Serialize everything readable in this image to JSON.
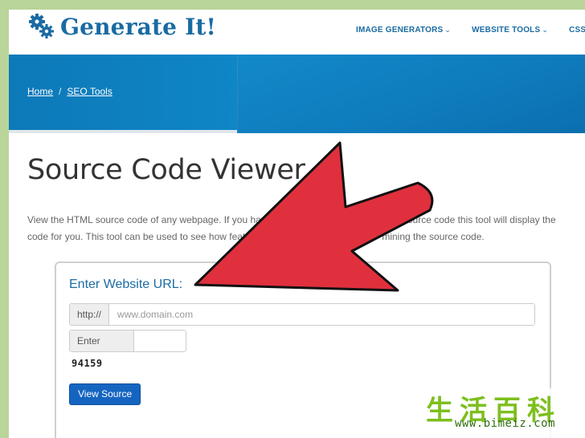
{
  "header": {
    "logo_text": "Generate It!",
    "logo_icon": "gears-icon",
    "nav": [
      {
        "label": "IMAGE GENERATORS",
        "caret": "⌄"
      },
      {
        "label": "WEBSITE TOOLS",
        "caret": "⌄"
      },
      {
        "label": "CSS GE",
        "caret": ""
      }
    ]
  },
  "breadcrumb": {
    "home": "Home",
    "separator": "/",
    "current": "SEO Tools"
  },
  "page": {
    "title": "Source Code Viewer",
    "desc_line1": "View the HTML source code of any webpage. If you hav                                                   source code this tool will display the",
    "desc_line2": "code for you. This tool can be used to see how featu                                                 mining the source code."
  },
  "form": {
    "title": "Enter Website URL:",
    "url_prefix": "http://",
    "url_placeholder": "www.domain.com",
    "url_value": "",
    "code_label": "Enter Code:",
    "code_value": "",
    "captcha": "94159",
    "submit_label": "View Source"
  },
  "overlay": {
    "arrow_color": "#e0303d",
    "arrow_outline": "#111111"
  },
  "watermark": {
    "chars": "生活百科",
    "url": "www.bimeiz.com"
  },
  "colors": {
    "brand": "#1a6ba3",
    "banner": "#0f86c6",
    "button": "#1565c0",
    "frame_bg": "#b9d59a"
  }
}
